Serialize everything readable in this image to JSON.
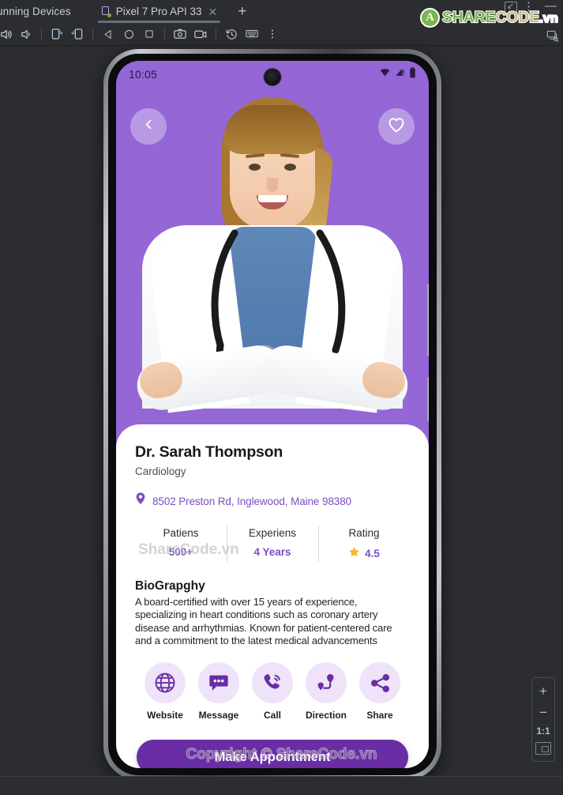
{
  "ide": {
    "panel_title": "unning Devices",
    "tab": {
      "label": "Pixel 7 Pro API 33",
      "close": "✕",
      "icon": "device-screen-icon"
    },
    "new_tab_label": "+",
    "window_controls": {
      "minimize_label": "—",
      "more_label": "⋮",
      "collapse_label": "↙"
    },
    "toolbar_buttons": [
      {
        "name": "volume-up-icon",
        "label": "Volume Up"
      },
      {
        "name": "volume-down-icon",
        "label": "Volume Down"
      },
      {
        "name": "rotate-left-icon",
        "label": "Rotate Left"
      },
      {
        "name": "rotate-right-icon",
        "label": "Rotate Right"
      },
      {
        "name": "back-nav-icon",
        "label": "Back"
      },
      {
        "name": "home-nav-icon",
        "label": "Home"
      },
      {
        "name": "overview-nav-icon",
        "label": "Overview"
      },
      {
        "name": "screenshot-icon",
        "label": "Take Screenshot"
      },
      {
        "name": "record-icon",
        "label": "Record Screen"
      },
      {
        "name": "history-icon",
        "label": "History"
      },
      {
        "name": "keyboard-icon",
        "label": "Keyboard"
      },
      {
        "name": "more-icon",
        "label": "More"
      }
    ],
    "zoom_rail": {
      "zoom_in": "+",
      "zoom_out": "−",
      "actual_size": "1:1",
      "fit_label": "Fit to Screen"
    }
  },
  "watermark": {
    "logo_part_1": "SHARE",
    "logo_part_2": "CODE",
    "logo_part_3": ".vn",
    "logo_mark": "A",
    "bio_overlay": "ShareCode.vn",
    "copyright": "Copyright © ShareCode.vn"
  },
  "phone": {
    "status_bar": {
      "clock": "10:05",
      "icons": [
        "wifi-icon",
        "cellular-alert-icon",
        "battery-icon"
      ]
    },
    "hero": {
      "back_button": "back-chevron-icon",
      "favorite_button": "heart-icon",
      "background_color": "#9466d6",
      "photo_alt": "doctor-portrait"
    },
    "profile": {
      "name": "Dr. Sarah Thompson",
      "specialty": "Cardiology",
      "address": "8502 Preston Rd, Inglewood, Maine 98380",
      "address_icon": "location-pin-icon"
    },
    "stats": [
      {
        "label": "Patiens",
        "value": "500+",
        "icon": ""
      },
      {
        "label": "Experiens",
        "value": "4 Years",
        "icon": ""
      },
      {
        "label": "Rating",
        "value": "4.5",
        "icon": "star-icon"
      }
    ],
    "bio": {
      "title": "BioGrapghy",
      "text": "A board-certified with over 15 years of experience,  specializing in heart conditions such as coronary artery  disease and arrhythmias. Known for patient-centered care  and a commitment to the latest medical advancements"
    },
    "actions": [
      {
        "label": "Website",
        "icon": "globe-www-icon"
      },
      {
        "label": "Message",
        "icon": "message-bubble-icon"
      },
      {
        "label": "Call",
        "icon": "phone-call-icon"
      },
      {
        "label": "Direction",
        "icon": "directions-route-icon"
      },
      {
        "label": "Share",
        "icon": "share-nodes-icon"
      }
    ],
    "cta": {
      "label": "Make Appointment"
    }
  },
  "colors": {
    "hero_purple": "#9466d6",
    "accent_purple": "#7a4fc0",
    "button_purple": "#6a2da5",
    "chip_lavender": "#eee3f8",
    "star_yellow": "#f5b824",
    "ide_background": "#2b2d30"
  }
}
